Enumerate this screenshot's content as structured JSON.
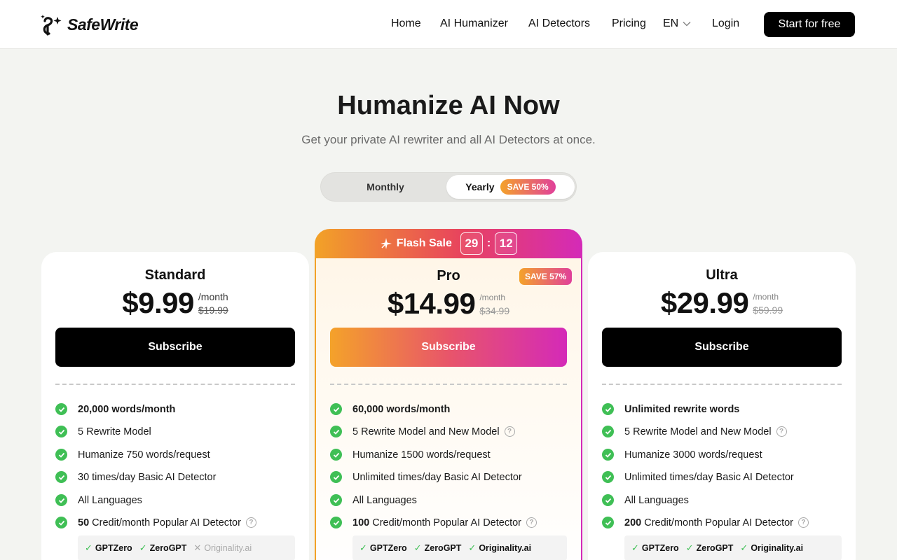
{
  "brand": {
    "name": "SafeWrite"
  },
  "nav": {
    "home": "Home",
    "humanizer": "AI Humanizer",
    "detectors": "AI Detectors",
    "pricing": "Pricing",
    "lang": "EN",
    "login": "Login",
    "cta": "Start for free"
  },
  "hero": {
    "title": "Humanize AI Now",
    "subtitle": "Get your private AI rewriter and all AI Detectors at once."
  },
  "billing": {
    "monthly": "Monthly",
    "yearly": "Yearly",
    "save": "SAVE 50%"
  },
  "flash_sale": {
    "label": "Flash Sale",
    "minutes": "29",
    "sep": ":",
    "seconds": "12"
  },
  "plans": {
    "standard": {
      "name": "Standard",
      "price": "$9.99",
      "period": "/month",
      "old_price": "$19.99",
      "button": "Subscribe",
      "f1": "20,000 words/month",
      "f2": "5 Rewrite Model",
      "f3": "Humanize 750 words/request",
      "f4": "30 times/day Basic AI Detector",
      "f5": "All Languages",
      "f6_num": "50",
      "f6_text": "Credit/month Popular AI Detector",
      "d1": "GPTZero",
      "d2": "ZeroGPT",
      "d3": "Originality.ai"
    },
    "pro": {
      "name": "Pro",
      "price": "$14.99",
      "period": "/month",
      "old_price": "$34.99",
      "badge": "SAVE 57%",
      "button": "Subscribe",
      "f1": "60,000 words/month",
      "f2": "5 Rewrite Model and New Model",
      "f3": "Humanize 1500 words/request",
      "f4": "Unlimited times/day Basic AI Detector",
      "f5": "All Languages",
      "f6_num": "100",
      "f6_text": "Credit/month Popular AI Detector",
      "d1": "GPTZero",
      "d2": "ZeroGPT",
      "d3": "Originality.ai"
    },
    "ultra": {
      "name": "Ultra",
      "price": "$29.99",
      "period": "/month",
      "old_price": "$59.99",
      "button": "Subscribe",
      "f1": "Unlimited rewrite words",
      "f2": "5 Rewrite Model and New Model",
      "f3": "Humanize 3000 words/request",
      "f4": "Unlimited times/day Basic AI Detector",
      "f5": "All Languages",
      "f6_num": "200",
      "f6_text": "Credit/month Popular AI Detector",
      "d1": "GPTZero",
      "d2": "ZeroGPT",
      "d3": "Originality.ai"
    }
  },
  "icons": {
    "logo": "safewrite-logo-icon",
    "chevron": "chevron-down-icon",
    "check": "check-circle-icon",
    "help": "help-circle-icon",
    "sparkle": "sparkle-icon"
  },
  "colors": {
    "accent_orange": "#f4a22a",
    "accent_pink": "#d42ab8",
    "check_green": "#3fbf55"
  }
}
